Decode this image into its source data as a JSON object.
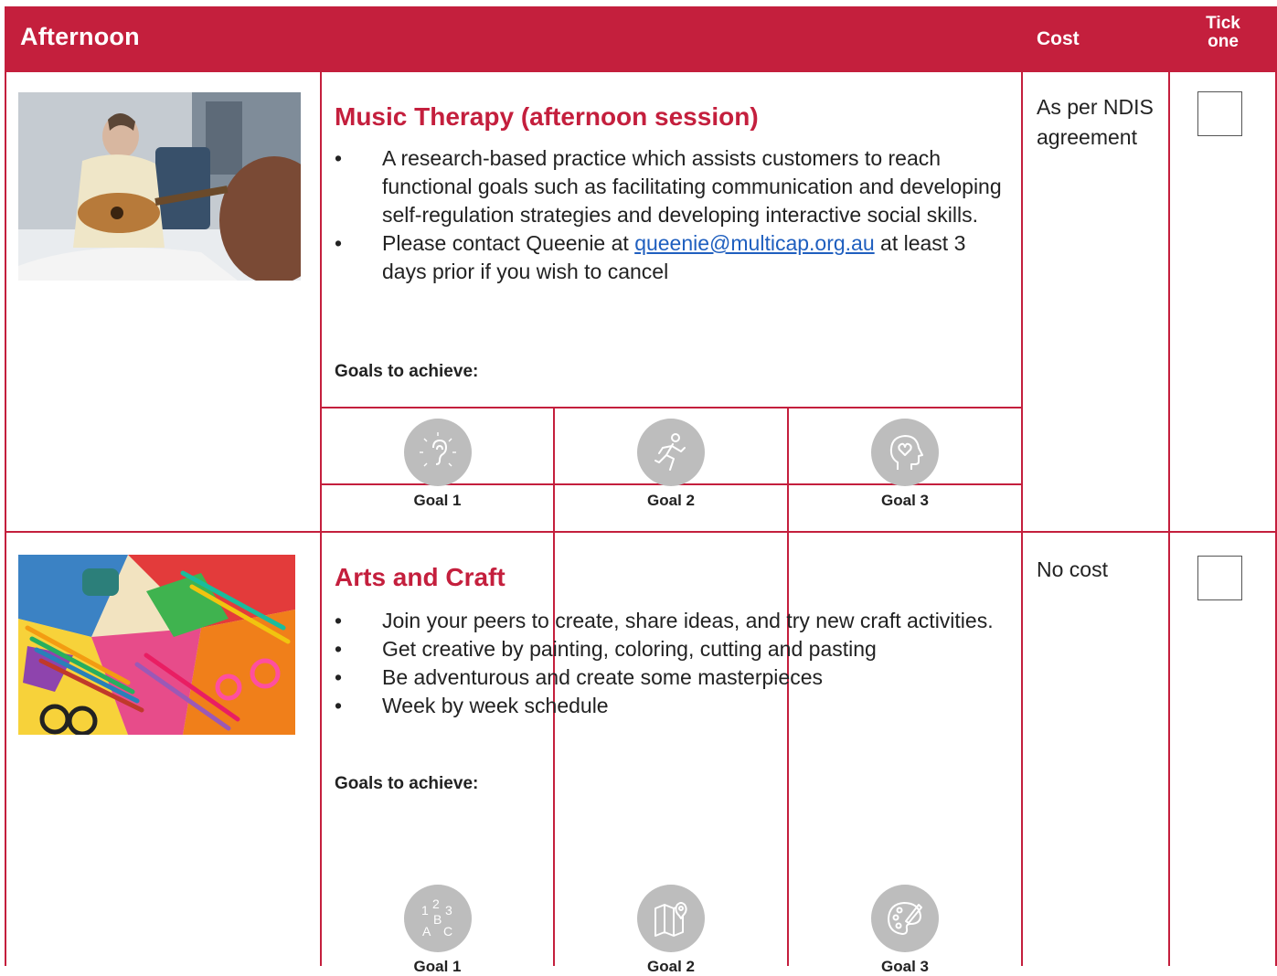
{
  "header": {
    "title": "Afternoon",
    "cost": "Cost",
    "tick_line1": "Tick",
    "tick_line2": "one"
  },
  "activities": [
    {
      "title": "Music Therapy (afternoon session)",
      "bullet1": "A research-based practice which assists customers to reach functional goals such as facilitating communication and developing self-regulation strategies and developing interactive social skills.",
      "bullet2_pre": "Please contact Queenie at ",
      "bullet2_email": "queenie@multicap.org.au",
      "bullet2_post": " at least 3 days prior if you wish to cancel",
      "goals_label": "Goals to achieve:",
      "cost": "As per NDIS agreement",
      "goals": [
        {
          "label": "Goal 1",
          "icon": "ear-icon"
        },
        {
          "label": "Goal 2",
          "icon": "running-person-icon"
        },
        {
          "label": "Goal 3",
          "icon": "head-heart-icon"
        }
      ]
    },
    {
      "title": "Arts and Craft",
      "bullets": [
        "Join your peers to create, share ideas, and try new craft activities.",
        "Get creative by painting, coloring, cutting and pasting",
        "Be adventurous and create some masterpieces",
        "Week by week schedule"
      ],
      "goals_label": "Goals to achieve:",
      "cost": "No cost",
      "goals": [
        {
          "label": "Goal 1",
          "icon": "numbers-letters-icon"
        },
        {
          "label": "Goal 2",
          "icon": "map-pin-icon"
        },
        {
          "label": "Goal 3",
          "icon": "paint-palette-icon"
        }
      ]
    }
  ],
  "colors": {
    "accent": "#c41f3d",
    "goal_circle": "#bdbdbd",
    "link": "#1f5fbf"
  }
}
